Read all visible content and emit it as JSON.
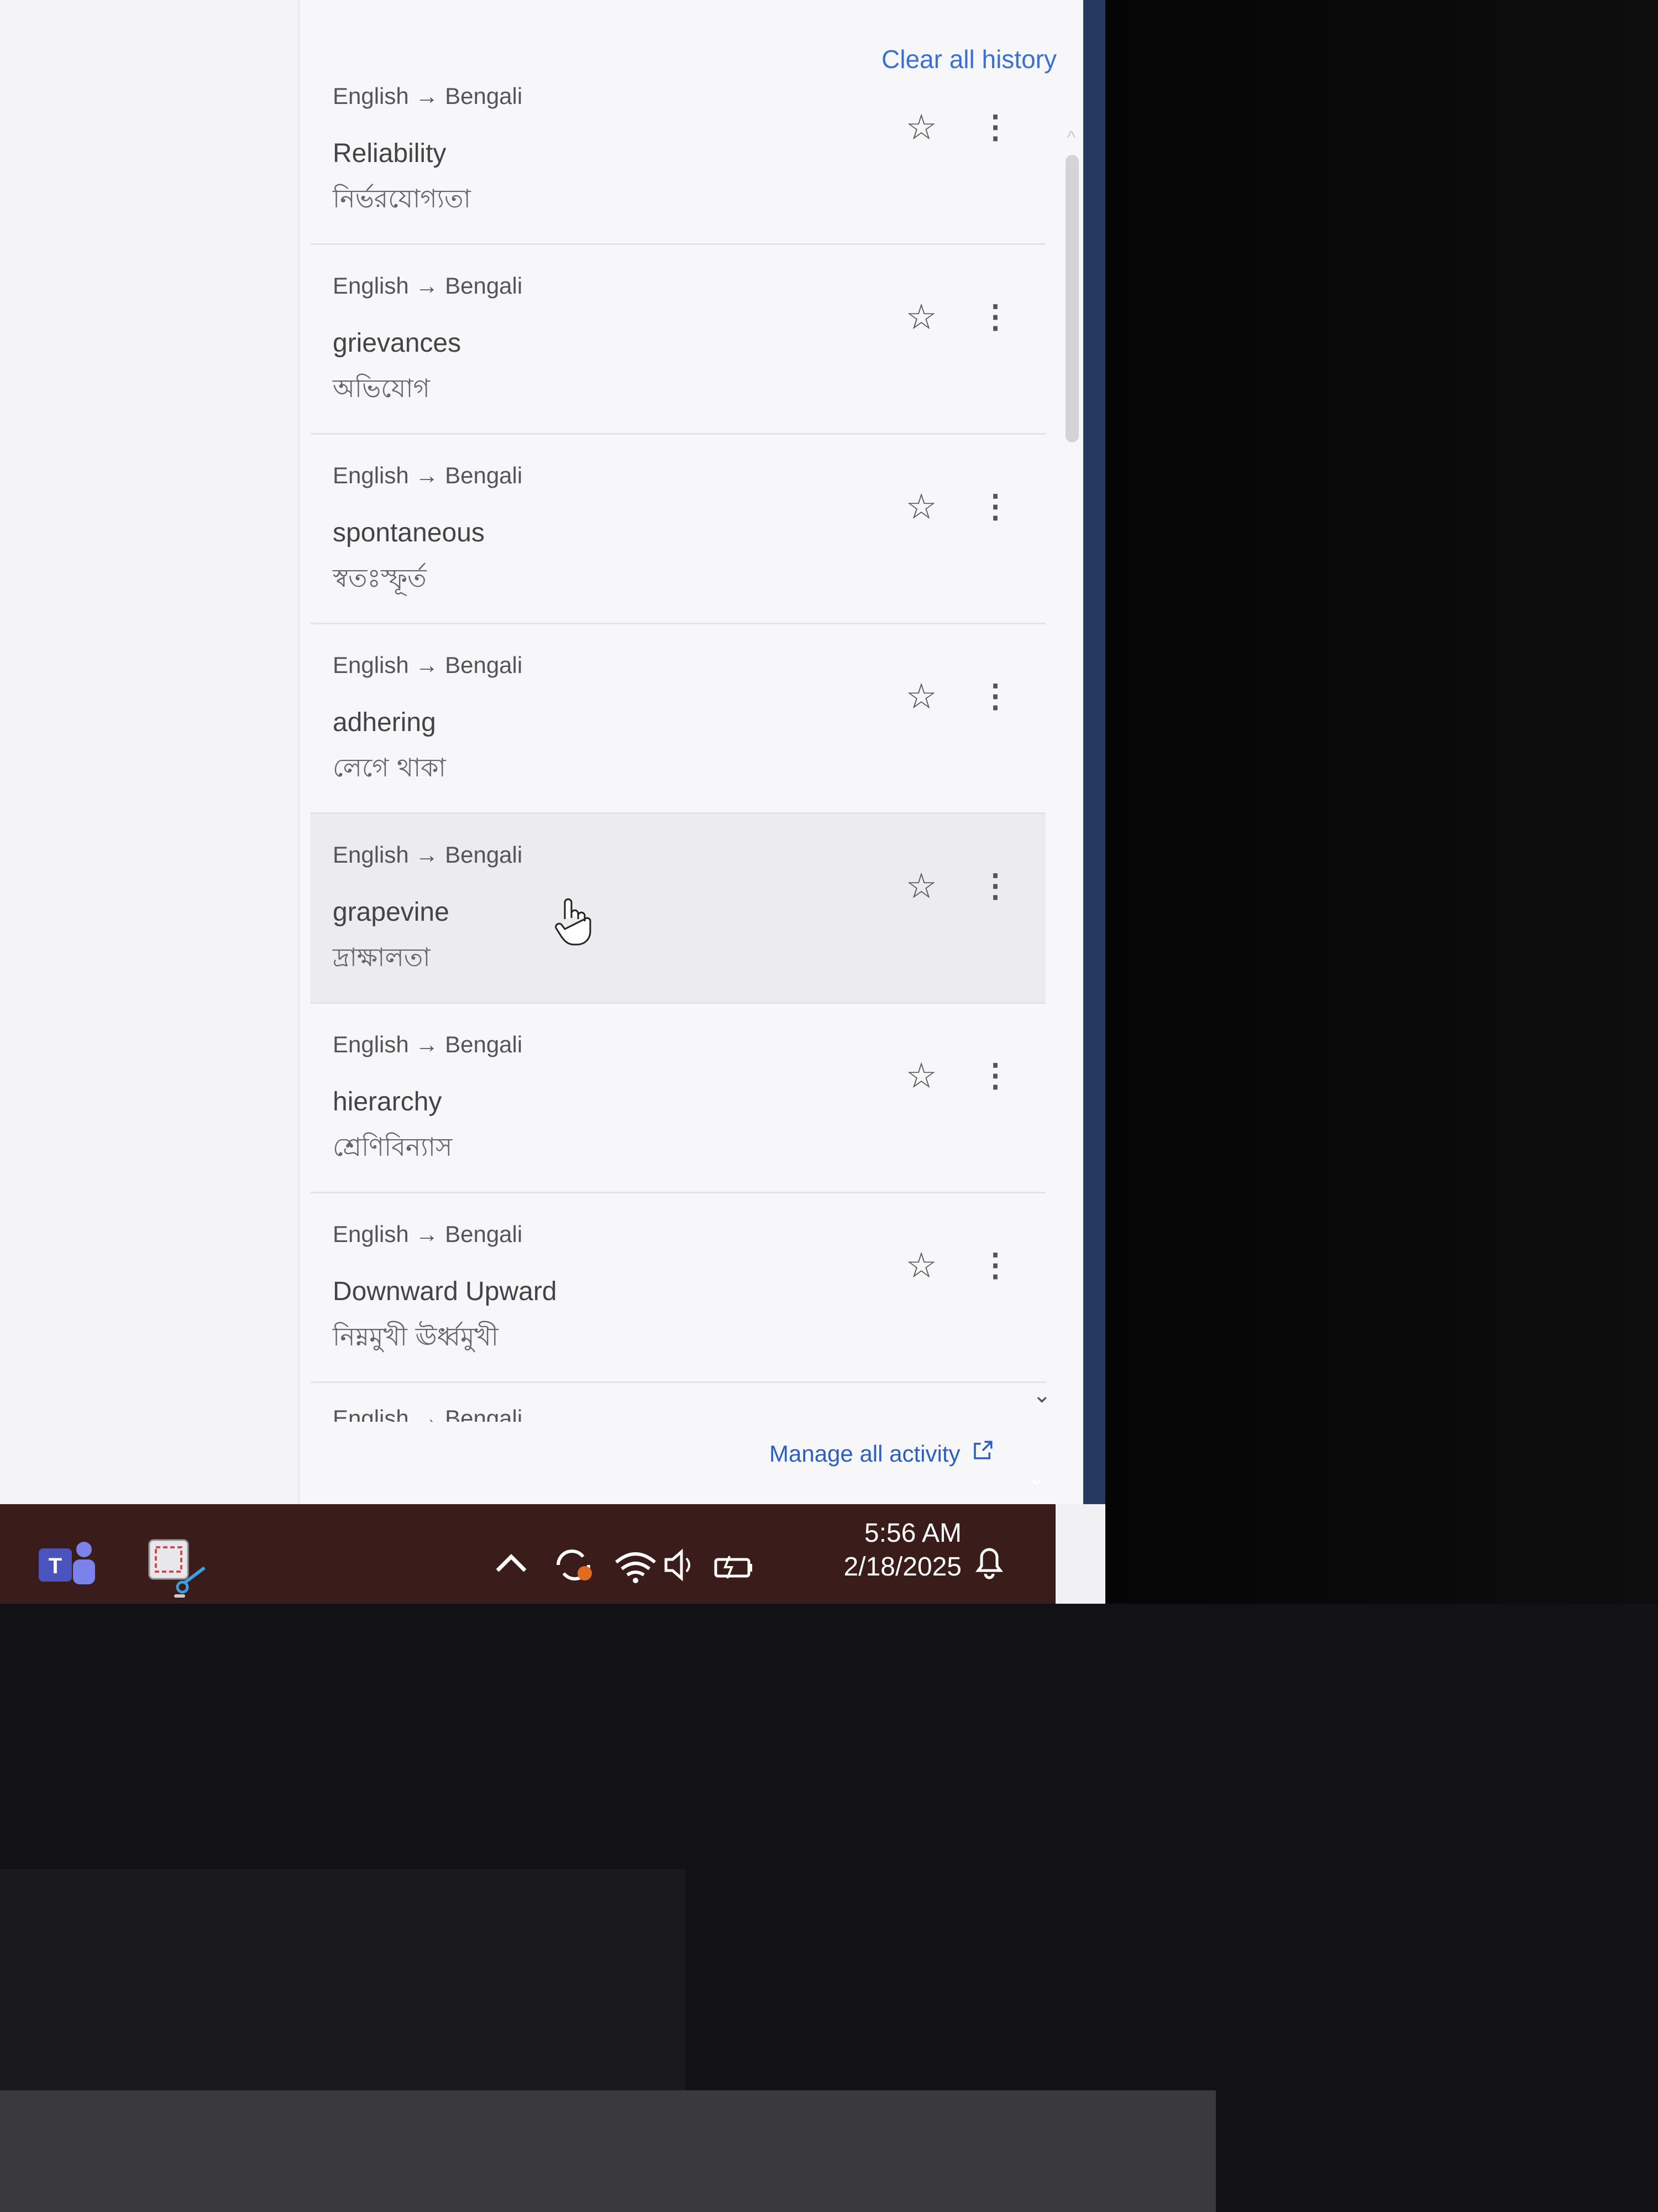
{
  "history": {
    "clear_label": "Clear all history",
    "manage_label": "Manage all activity",
    "entries": [
      {
        "lang": "English → Bengali",
        "source": "Reliability",
        "target": "নির্ভরযোগ্যতা"
      },
      {
        "lang": "English → Bengali",
        "source": "grievances",
        "target": "অভিযোগ"
      },
      {
        "lang": "English → Bengali",
        "source": "spontaneous",
        "target": "স্বতঃস্ফূর্ত"
      },
      {
        "lang": "English → Bengali",
        "source": "adhering",
        "target": "লেগে থাকা"
      },
      {
        "lang": "English → Bengali",
        "source": "grapevine",
        "target": "দ্রাক্ষালতা"
      },
      {
        "lang": "English → Bengali",
        "source": "hierarchy",
        "target": "শ্রেণিবিন্যাস"
      },
      {
        "lang": "English → Bengali",
        "source": "Downward Upward",
        "target": "নিম্নমুখী ঊর্ধ্বমুখী"
      }
    ],
    "partial_lang": "English → Bengali"
  },
  "icons": {
    "star": "star-outline-icon",
    "more": "more-vert-icon",
    "external": "open-in-new-icon",
    "chevron_down": "chevron-down-icon"
  },
  "taskbar": {
    "time": "5:56 AM",
    "date": "2/18/2025"
  },
  "colors": {
    "link": "#3b6fd4",
    "taskbar": "#3a1d1a"
  }
}
